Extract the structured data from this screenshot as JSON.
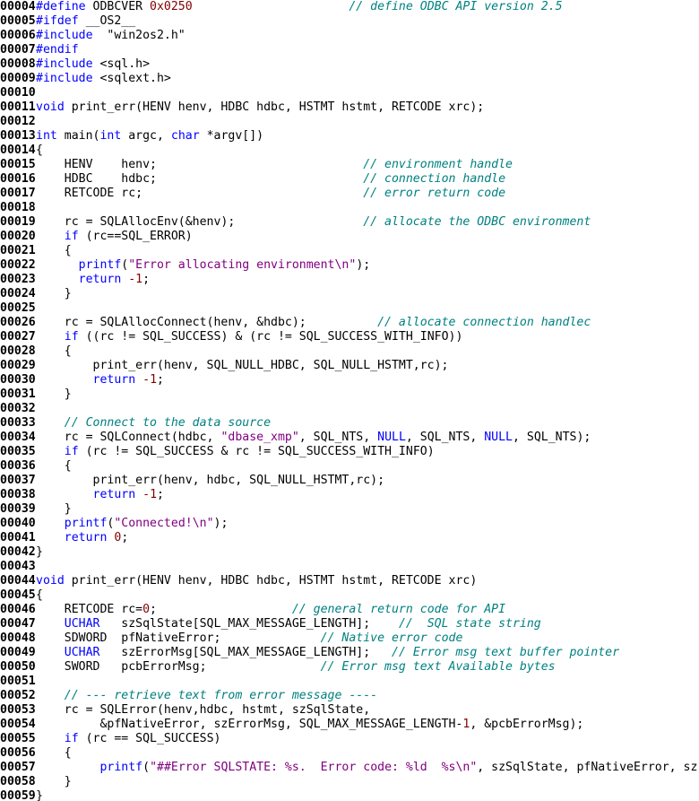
{
  "colors": {
    "background": "#ffffff",
    "line_number": "#000000",
    "keyword": "#0000ff",
    "comment": "#008080",
    "string": "#800080",
    "number": "#800000",
    "plain": "#000000"
  },
  "lines": [
    {
      "n": "00004",
      "t": [
        [
          "kw",
          "#define"
        ],
        [
          "p",
          " ODBCVER "
        ],
        [
          "num",
          "0x0250"
        ],
        [
          "p",
          "                      "
        ],
        [
          "cm",
          "// define ODBC API version 2.5"
        ]
      ]
    },
    {
      "n": "00005",
      "t": [
        [
          "kw",
          "#ifdef"
        ],
        [
          "p",
          " __OS2__"
        ]
      ]
    },
    {
      "n": "00006",
      "t": [
        [
          "kw",
          "#include"
        ],
        [
          "p",
          "  \"win2os2.h\""
        ]
      ]
    },
    {
      "n": "00007",
      "t": [
        [
          "kw",
          "#endif"
        ]
      ]
    },
    {
      "n": "00008",
      "t": [
        [
          "kw",
          "#include"
        ],
        [
          "p",
          " <sql.h>"
        ]
      ]
    },
    {
      "n": "00009",
      "t": [
        [
          "kw",
          "#include"
        ],
        [
          "p",
          " <sqlext.h>"
        ]
      ]
    },
    {
      "n": "00010",
      "t": []
    },
    {
      "n": "00011",
      "t": [
        [
          "kw",
          "void"
        ],
        [
          "p",
          " print_err(HENV henv, HDBC hdbc, HSTMT hstmt, RETCODE xrc);"
        ]
      ]
    },
    {
      "n": "00012",
      "t": []
    },
    {
      "n": "00013",
      "t": [
        [
          "kw",
          "int"
        ],
        [
          "p",
          " main("
        ],
        [
          "kw",
          "int"
        ],
        [
          "p",
          " argc, "
        ],
        [
          "kw",
          "char"
        ],
        [
          "p",
          " *argv[])"
        ]
      ]
    },
    {
      "n": "00014",
      "t": [
        [
          "p",
          "{"
        ]
      ]
    },
    {
      "n": "00015",
      "t": [
        [
          "p",
          "    HENV    henv;                             "
        ],
        [
          "cm",
          "// environment handle"
        ]
      ]
    },
    {
      "n": "00016",
      "t": [
        [
          "p",
          "    HDBC    hdbc;                             "
        ],
        [
          "cm",
          "// connection handle"
        ]
      ]
    },
    {
      "n": "00017",
      "t": [
        [
          "p",
          "    RETCODE rc;                               "
        ],
        [
          "cm",
          "// error return code"
        ]
      ]
    },
    {
      "n": "00018",
      "t": []
    },
    {
      "n": "00019",
      "t": [
        [
          "p",
          "    rc = SQLAllocEnv(&henv);                  "
        ],
        [
          "cm",
          "// allocate the ODBC environment"
        ]
      ]
    },
    {
      "n": "00020",
      "t": [
        [
          "p",
          "    "
        ],
        [
          "kw",
          "if"
        ],
        [
          "p",
          " (rc==SQL_ERROR)"
        ]
      ]
    },
    {
      "n": "00021",
      "t": [
        [
          "p",
          "    {"
        ]
      ]
    },
    {
      "n": "00022",
      "t": [
        [
          "p",
          "      "
        ],
        [
          "kw",
          "printf"
        ],
        [
          "p",
          "("
        ],
        [
          "str",
          "\"Error allocating environment\\n\""
        ],
        [
          "p",
          ");"
        ]
      ]
    },
    {
      "n": "00023",
      "t": [
        [
          "p",
          "      "
        ],
        [
          "kw",
          "return"
        ],
        [
          "p",
          " "
        ],
        [
          "num",
          "-1"
        ],
        [
          "p",
          ";"
        ]
      ]
    },
    {
      "n": "00024",
      "t": [
        [
          "p",
          "    }"
        ]
      ]
    },
    {
      "n": "00025",
      "t": []
    },
    {
      "n": "00026",
      "t": [
        [
          "p",
          "    rc = SQLAllocConnect(henv, &hdbc);          "
        ],
        [
          "cm",
          "// allocate connection handlec"
        ]
      ]
    },
    {
      "n": "00027",
      "t": [
        [
          "p",
          "    "
        ],
        [
          "kw",
          "if"
        ],
        [
          "p",
          " ((rc != SQL_SUCCESS) & (rc != SQL_SUCCESS_WITH_INFO))"
        ]
      ]
    },
    {
      "n": "00028",
      "t": [
        [
          "p",
          "    {"
        ]
      ]
    },
    {
      "n": "00029",
      "t": [
        [
          "p",
          "        print_err(henv, SQL_NULL_HDBC, SQL_NULL_HSTMT,rc);"
        ]
      ]
    },
    {
      "n": "00030",
      "t": [
        [
          "p",
          "        "
        ],
        [
          "kw",
          "return"
        ],
        [
          "p",
          " "
        ],
        [
          "num",
          "-1"
        ],
        [
          "p",
          ";"
        ]
      ]
    },
    {
      "n": "00031",
      "t": [
        [
          "p",
          "    }"
        ]
      ]
    },
    {
      "n": "00032",
      "t": []
    },
    {
      "n": "00033",
      "t": [
        [
          "p",
          "    "
        ],
        [
          "cm",
          "// Connect to the data source"
        ]
      ]
    },
    {
      "n": "00034",
      "t": [
        [
          "p",
          "    rc = SQLConnect(hdbc, "
        ],
        [
          "str",
          "\"dbase_xmp\""
        ],
        [
          "p",
          ", SQL_NTS, "
        ],
        [
          "kw",
          "NULL"
        ],
        [
          "p",
          ", SQL_NTS, "
        ],
        [
          "kw",
          "NULL"
        ],
        [
          "p",
          ", SQL_NTS);"
        ]
      ]
    },
    {
      "n": "00035",
      "t": [
        [
          "p",
          "    "
        ],
        [
          "kw",
          "if"
        ],
        [
          "p",
          " (rc != SQL_SUCCESS & rc != SQL_SUCCESS_WITH_INFO)"
        ]
      ]
    },
    {
      "n": "00036",
      "t": [
        [
          "p",
          "    {"
        ]
      ]
    },
    {
      "n": "00037",
      "t": [
        [
          "p",
          "        print_err(henv, hdbc, SQL_NULL_HSTMT,rc);"
        ]
      ]
    },
    {
      "n": "00038",
      "t": [
        [
          "p",
          "        "
        ],
        [
          "kw",
          "return"
        ],
        [
          "p",
          " "
        ],
        [
          "num",
          "-1"
        ],
        [
          "p",
          ";"
        ]
      ]
    },
    {
      "n": "00039",
      "t": [
        [
          "p",
          "    }"
        ]
      ]
    },
    {
      "n": "00040",
      "t": [
        [
          "p",
          "    "
        ],
        [
          "kw",
          "printf"
        ],
        [
          "p",
          "("
        ],
        [
          "str",
          "\"Connected!\\n\""
        ],
        [
          "p",
          ");"
        ]
      ]
    },
    {
      "n": "00041",
      "t": [
        [
          "p",
          "    "
        ],
        [
          "kw",
          "return"
        ],
        [
          "p",
          " "
        ],
        [
          "num",
          "0"
        ],
        [
          "p",
          ";"
        ]
      ]
    },
    {
      "n": "00042",
      "t": [
        [
          "p",
          "}"
        ]
      ]
    },
    {
      "n": "00043",
      "t": []
    },
    {
      "n": "00044",
      "t": [
        [
          "kw",
          "void"
        ],
        [
          "p",
          " print_err(HENV henv, HDBC hdbc, HSTMT hstmt, RETCODE xrc)"
        ]
      ]
    },
    {
      "n": "00045",
      "t": [
        [
          "p",
          "{"
        ]
      ]
    },
    {
      "n": "00046",
      "t": [
        [
          "p",
          "    RETCODE rc="
        ],
        [
          "num",
          "0"
        ],
        [
          "p",
          ";                   "
        ],
        [
          "cm",
          "// general return code for API"
        ]
      ]
    },
    {
      "n": "00047",
      "t": [
        [
          "p",
          "    "
        ],
        [
          "kw",
          "UCHAR"
        ],
        [
          "p",
          "   szSqlState[SQL_MAX_MESSAGE_LENGTH];    "
        ],
        [
          "cm",
          "//  SQL state string"
        ]
      ]
    },
    {
      "n": "00048",
      "t": [
        [
          "p",
          "    SDWORD  pfNativeError;              "
        ],
        [
          "cm",
          "// Native error code"
        ]
      ]
    },
    {
      "n": "00049",
      "t": [
        [
          "p",
          "    "
        ],
        [
          "kw",
          "UCHAR"
        ],
        [
          "p",
          "   szErrorMsg[SQL_MAX_MESSAGE_LENGTH];   "
        ],
        [
          "cm",
          "// Error msg text buffer pointer"
        ]
      ]
    },
    {
      "n": "00050",
      "t": [
        [
          "p",
          "    SWORD   pcbErrorMsg;                "
        ],
        [
          "cm",
          "// Error msg text Available bytes"
        ]
      ]
    },
    {
      "n": "00051",
      "t": []
    },
    {
      "n": "00052",
      "t": [
        [
          "p",
          "    "
        ],
        [
          "cm",
          "// --- retrieve text from error message ----"
        ]
      ]
    },
    {
      "n": "00053",
      "t": [
        [
          "p",
          "    rc = SQLError(henv,hdbc, hstmt, szSqlState,"
        ]
      ]
    },
    {
      "n": "00054",
      "t": [
        [
          "p",
          "         &pfNativeError, szErrorMsg, SQL_MAX_MESSAGE_LENGTH-"
        ],
        [
          "num",
          "1"
        ],
        [
          "p",
          ", &pcbErrorMsg);"
        ]
      ]
    },
    {
      "n": "00055",
      "t": [
        [
          "p",
          "    "
        ],
        [
          "kw",
          "if"
        ],
        [
          "p",
          " (rc == SQL_SUCCESS)"
        ]
      ]
    },
    {
      "n": "00056",
      "t": [
        [
          "p",
          "    {"
        ]
      ]
    },
    {
      "n": "00057",
      "t": [
        [
          "p",
          "         "
        ],
        [
          "kw",
          "printf"
        ],
        [
          "p",
          "("
        ],
        [
          "str",
          "\"##Error SQLSTATE: %s.  Error code: %ld  %s\\n\""
        ],
        [
          "p",
          ", szSqlState, pfNativeError, sz"
        ]
      ]
    },
    {
      "n": "00058",
      "t": [
        [
          "p",
          "    }"
        ]
      ]
    },
    {
      "n": "00059",
      "t": [
        [
          "p",
          "}"
        ]
      ]
    }
  ]
}
